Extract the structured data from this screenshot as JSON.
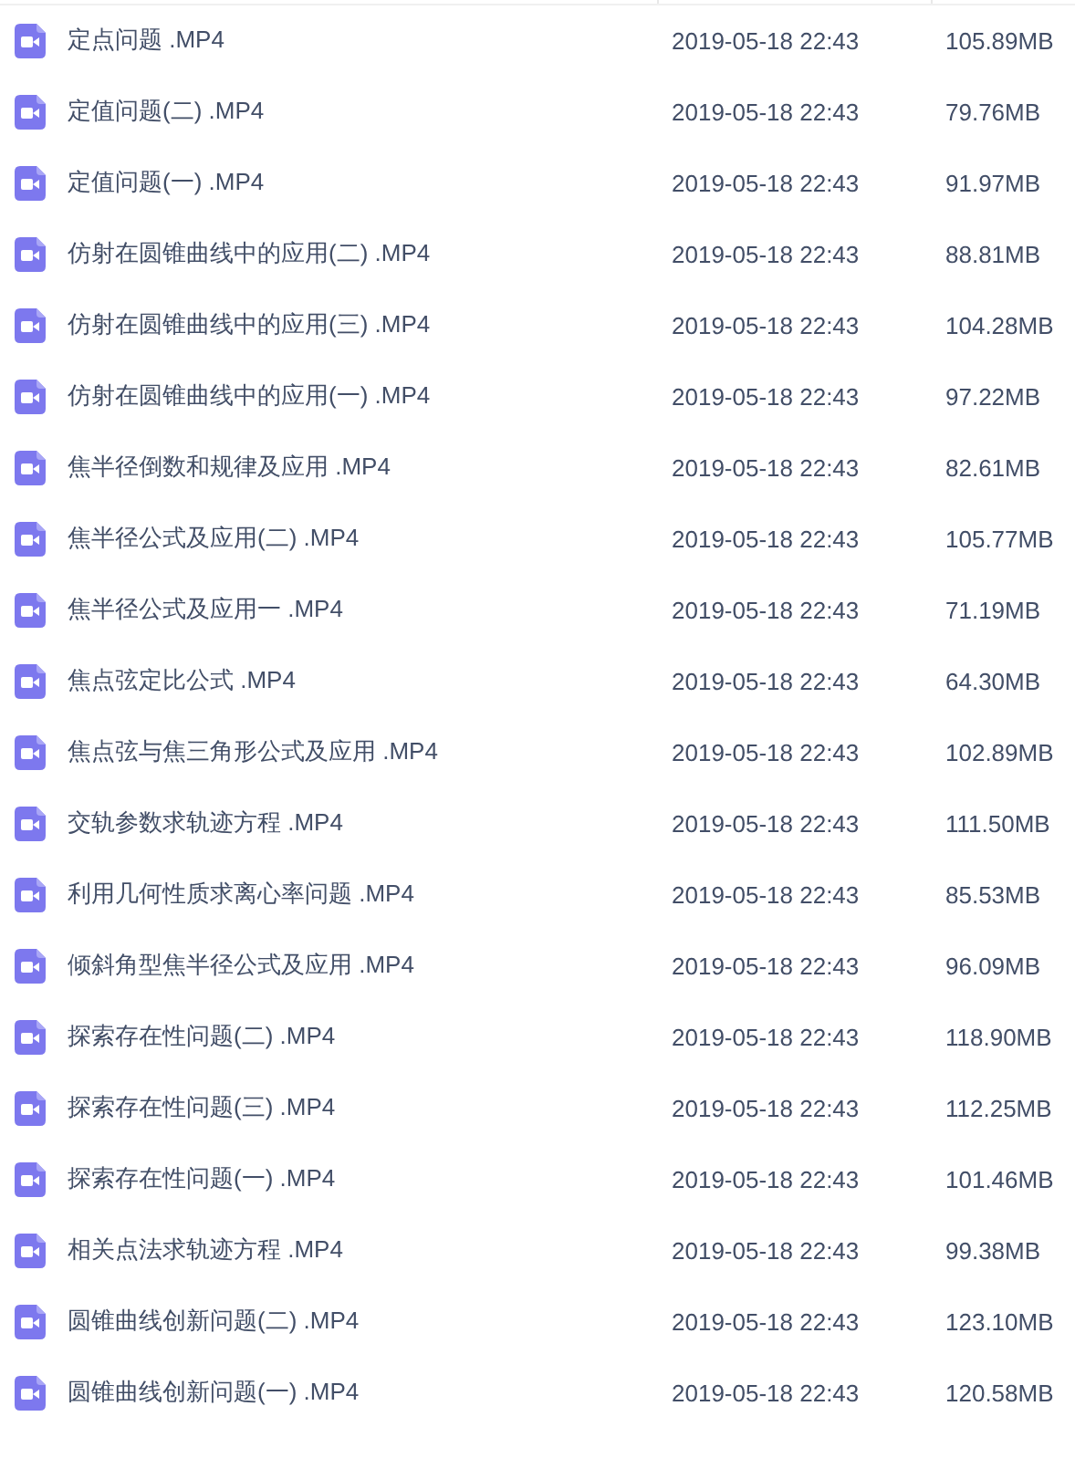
{
  "files": [
    {
      "name": "定点问题 .MP4",
      "date": "2019-05-18 22:43",
      "size": "105.89MB"
    },
    {
      "name": "定值问题(二) .MP4",
      "date": "2019-05-18 22:43",
      "size": "79.76MB"
    },
    {
      "name": "定值问题(一) .MP4",
      "date": "2019-05-18 22:43",
      "size": "91.97MB"
    },
    {
      "name": "仿射在圆锥曲线中的应用(二) .MP4",
      "date": "2019-05-18 22:43",
      "size": "88.81MB"
    },
    {
      "name": "仿射在圆锥曲线中的应用(三) .MP4",
      "date": "2019-05-18 22:43",
      "size": "104.28MB"
    },
    {
      "name": "仿射在圆锥曲线中的应用(一) .MP4",
      "date": "2019-05-18 22:43",
      "size": "97.22MB"
    },
    {
      "name": "焦半径倒数和规律及应用 .MP4",
      "date": "2019-05-18 22:43",
      "size": "82.61MB"
    },
    {
      "name": "焦半径公式及应用(二) .MP4",
      "date": "2019-05-18 22:43",
      "size": "105.77MB"
    },
    {
      "name": "焦半径公式及应用一 .MP4",
      "date": "2019-05-18 22:43",
      "size": "71.19MB"
    },
    {
      "name": "焦点弦定比公式 .MP4",
      "date": "2019-05-18 22:43",
      "size": "64.30MB"
    },
    {
      "name": "焦点弦与焦三角形公式及应用 .MP4",
      "date": "2019-05-18 22:43",
      "size": "102.89MB"
    },
    {
      "name": "交轨参数求轨迹方程 .MP4",
      "date": "2019-05-18 22:43",
      "size": "111.50MB"
    },
    {
      "name": "利用几何性质求离心率问题 .MP4",
      "date": "2019-05-18 22:43",
      "size": "85.53MB"
    },
    {
      "name": "倾斜角型焦半径公式及应用 .MP4",
      "date": "2019-05-18 22:43",
      "size": "96.09MB"
    },
    {
      "name": "探索存在性问题(二) .MP4",
      "date": "2019-05-18 22:43",
      "size": "118.90MB"
    },
    {
      "name": "探索存在性问题(三) .MP4",
      "date": "2019-05-18 22:43",
      "size": "112.25MB"
    },
    {
      "name": "探索存在性问题(一) .MP4",
      "date": "2019-05-18 22:43",
      "size": "101.46MB"
    },
    {
      "name": "相关点法求轨迹方程 .MP4",
      "date": "2019-05-18 22:43",
      "size": "99.38MB"
    },
    {
      "name": "圆锥曲线创新问题(二) .MP4",
      "date": "2019-05-18 22:43",
      "size": "123.10MB"
    },
    {
      "name": "圆锥曲线创新问题(一) .MP4",
      "date": "2019-05-18 22:43",
      "size": "120.58MB"
    }
  ]
}
